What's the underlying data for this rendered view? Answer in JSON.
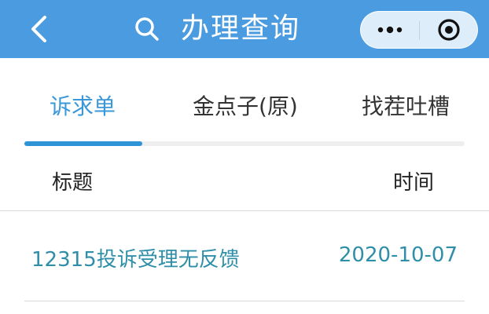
{
  "header": {
    "title": "办理查询",
    "back_icon": "chevron-left-icon",
    "search_icon": "search-icon",
    "more_icon": "more-dots-icon",
    "close_icon": "target-close-icon",
    "background_color": "#4a9be0"
  },
  "tabs": [
    {
      "label": "诉求单",
      "active": true
    },
    {
      "label": "金点子(原)",
      "active": false
    },
    {
      "label": "找茬吐槽",
      "active": false
    }
  ],
  "accent_color": "#2f93d8",
  "table": {
    "columns": [
      "标题",
      "时间"
    ],
    "rows": [
      {
        "title": "12315投诉受理无反馈",
        "date": "2020-10-07"
      }
    ]
  }
}
